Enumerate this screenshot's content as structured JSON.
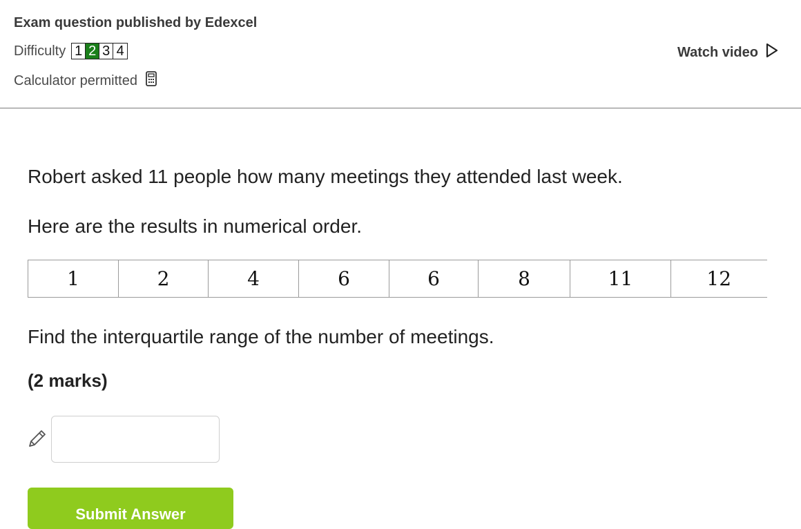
{
  "header": {
    "publisher": "Exam question published by Edexcel",
    "difficulty_label": "Difficulty",
    "levels": [
      "1",
      "2",
      "3",
      "4"
    ],
    "active_level": 2,
    "calculator_label": "Calculator permitted",
    "watch_video_label": "Watch video"
  },
  "question": {
    "line1": "Robert asked 11 people how many meetings they attended last week.",
    "line2": "Here are the results in numerical order.",
    "values": [
      "1",
      "2",
      "4",
      "6",
      "6",
      "8",
      "11",
      "12"
    ],
    "line3": "Find the interquartile range of the number of meetings.",
    "marks": "(2 marks)"
  },
  "answer": {
    "value": "",
    "placeholder": ""
  },
  "submit_label": "Submit Answer",
  "colors": {
    "active_level": "#1a7f1a",
    "submit": "#8fcb1e"
  }
}
